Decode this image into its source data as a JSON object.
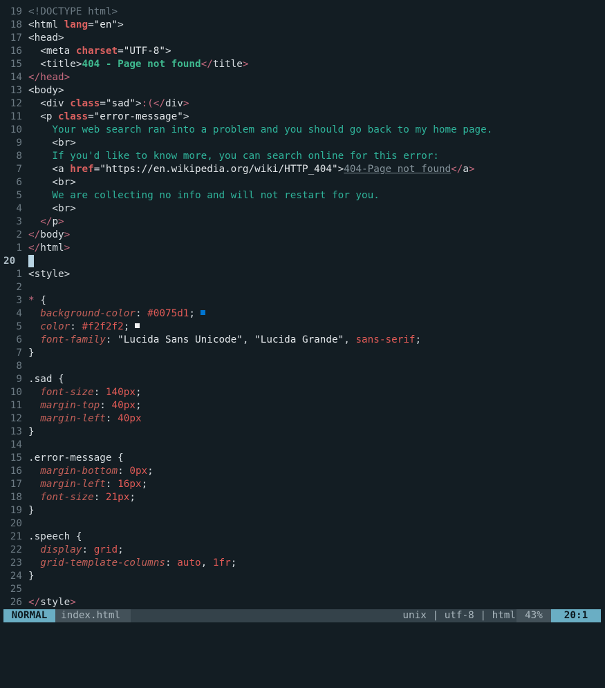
{
  "editor": {
    "cursor_line_number": "20",
    "html_lines": [
      {
        "n": "19",
        "parts": [
          {
            "c": "c-doctype",
            "t": "<!DOCTYPE html>"
          }
        ]
      },
      {
        "n": "18",
        "parts": [
          {
            "c": "c-tag",
            "t": "<html "
          },
          {
            "c": "c-attr",
            "t": "lang"
          },
          {
            "c": "c-eq",
            "t": "="
          },
          {
            "c": "c-str",
            "t": "\"en\""
          },
          {
            "c": "c-tag",
            "t": ">"
          }
        ]
      },
      {
        "n": "17",
        "parts": [
          {
            "c": "c-tag",
            "t": "<head>"
          }
        ]
      },
      {
        "n": "16",
        "parts": [
          {
            "c": "c-tag",
            "t": "  <meta "
          },
          {
            "c": "c-attr",
            "t": "charset"
          },
          {
            "c": "c-eq",
            "t": "="
          },
          {
            "c": "c-str",
            "t": "\"UTF-8\""
          },
          {
            "c": "c-tag",
            "t": ">"
          }
        ]
      },
      {
        "n": "15",
        "parts": [
          {
            "c": "c-tag",
            "t": "  <title>"
          },
          {
            "c": "c-title",
            "t": "404 - Page not found"
          },
          {
            "c": "c-endtag",
            "t": "</"
          },
          {
            "c": "c-tag",
            "t": "title"
          },
          {
            "c": "c-endtag",
            "t": ">"
          }
        ]
      },
      {
        "n": "14",
        "parts": [
          {
            "c": "c-endtag",
            "t": "</head>"
          }
        ]
      },
      {
        "n": "13",
        "parts": [
          {
            "c": "c-tag",
            "t": "<body>"
          }
        ]
      },
      {
        "n": "12",
        "parts": [
          {
            "c": "c-tag",
            "t": "  <div "
          },
          {
            "c": "c-attr",
            "t": "class"
          },
          {
            "c": "c-eq",
            "t": "="
          },
          {
            "c": "c-str",
            "t": "\"sad\""
          },
          {
            "c": "c-tag",
            "t": ">"
          },
          {
            "c": "c-sad",
            "t": ":("
          },
          {
            "c": "c-endtag",
            "t": "</"
          },
          {
            "c": "c-tag",
            "t": "div"
          },
          {
            "c": "c-endtag",
            "t": ">"
          }
        ]
      },
      {
        "n": "11",
        "parts": [
          {
            "c": "c-tag",
            "t": "  <p "
          },
          {
            "c": "c-attr",
            "t": "class"
          },
          {
            "c": "c-eq",
            "t": "="
          },
          {
            "c": "c-str",
            "t": "\"error-message\""
          },
          {
            "c": "c-tag",
            "t": ">"
          }
        ]
      },
      {
        "n": "10",
        "parts": [
          {
            "c": "c-text",
            "t": "    Your web search ran into a problem and you should go back to my home page."
          }
        ]
      },
      {
        "n": "9",
        "parts": [
          {
            "c": "c-tag",
            "t": "    <br>"
          }
        ]
      },
      {
        "n": "8",
        "parts": [
          {
            "c": "c-text",
            "t": "    If you'd like to know more, you can search online for this error:"
          }
        ]
      },
      {
        "n": "7",
        "parts": [
          {
            "c": "c-tag",
            "t": "    <a "
          },
          {
            "c": "c-attr",
            "t": "href"
          },
          {
            "c": "c-eq",
            "t": "="
          },
          {
            "c": "c-str",
            "t": "\"https://en.wikipedia.org/wiki/HTTP_404\""
          },
          {
            "c": "c-tag",
            "t": ">"
          },
          {
            "c": "c-link",
            "t": "404-Page not found"
          },
          {
            "c": "c-endtag",
            "t": "</"
          },
          {
            "c": "c-tag",
            "t": "a"
          },
          {
            "c": "c-endtag",
            "t": ">"
          }
        ]
      },
      {
        "n": "6",
        "parts": [
          {
            "c": "c-tag",
            "t": "    <br>"
          }
        ]
      },
      {
        "n": "5",
        "parts": [
          {
            "c": "c-text",
            "t": "    We are collecting no info and will not restart for you."
          }
        ]
      },
      {
        "n": "4",
        "parts": [
          {
            "c": "c-tag",
            "t": "    <br>"
          }
        ]
      },
      {
        "n": "3",
        "parts": [
          {
            "c": "c-endtag",
            "t": "  </"
          },
          {
            "c": "c-tag",
            "t": "p"
          },
          {
            "c": "c-endtag",
            "t": ">"
          }
        ]
      },
      {
        "n": "2",
        "parts": [
          {
            "c": "c-endtag",
            "t": "</"
          },
          {
            "c": "c-tag",
            "t": "body"
          },
          {
            "c": "c-endtag",
            "t": ">"
          }
        ]
      },
      {
        "n": "1",
        "parts": [
          {
            "c": "c-endtag",
            "t": "</"
          },
          {
            "c": "c-tag",
            "t": "html"
          },
          {
            "c": "c-endtag",
            "t": ">"
          }
        ]
      }
    ],
    "css_lines": [
      {
        "n": "1",
        "parts": [
          {
            "c": "c-tag",
            "t": "<style>"
          }
        ]
      },
      {
        "n": "2",
        "parts": []
      },
      {
        "n": "3",
        "parts": [
          {
            "c": "c-endtag",
            "t": "*"
          },
          {
            "c": "c-brace",
            "t": " {"
          }
        ]
      },
      {
        "n": "4",
        "parts": [
          {
            "c": "c-prop",
            "t": "  background-color"
          },
          {
            "c": "c-colon",
            "t": ": "
          },
          {
            "c": "c-val",
            "t": "#0075d1"
          },
          {
            "c": "c-colon",
            "t": ";"
          }
        ],
        "swatch": "#0075d1"
      },
      {
        "n": "5",
        "parts": [
          {
            "c": "c-prop",
            "t": "  color"
          },
          {
            "c": "c-colon",
            "t": ": "
          },
          {
            "c": "c-val",
            "t": "#f2f2f2"
          },
          {
            "c": "c-colon",
            "t": ";"
          }
        ],
        "swatch": "#f2f2f2"
      },
      {
        "n": "6",
        "parts": [
          {
            "c": "c-prop",
            "t": "  font-family"
          },
          {
            "c": "c-colon",
            "t": ": "
          },
          {
            "c": "c-valstr",
            "t": "\"Lucida Sans Unicode\""
          },
          {
            "c": "c-comma",
            "t": ", "
          },
          {
            "c": "c-valstr",
            "t": "\"Lucida Grande\""
          },
          {
            "c": "c-comma",
            "t": ", "
          },
          {
            "c": "c-val",
            "t": "sans-serif"
          },
          {
            "c": "c-colon",
            "t": ";"
          }
        ]
      },
      {
        "n": "7",
        "parts": [
          {
            "c": "c-brace",
            "t": "}"
          }
        ]
      },
      {
        "n": "8",
        "parts": []
      },
      {
        "n": "9",
        "parts": [
          {
            "c": "c-sel",
            "t": ".sad {"
          }
        ]
      },
      {
        "n": "10",
        "parts": [
          {
            "c": "c-prop",
            "t": "  font-size"
          },
          {
            "c": "c-colon",
            "t": ": "
          },
          {
            "c": "c-val",
            "t": "140px"
          },
          {
            "c": "c-colon",
            "t": ";"
          }
        ]
      },
      {
        "n": "11",
        "parts": [
          {
            "c": "c-prop",
            "t": "  margin-top"
          },
          {
            "c": "c-colon",
            "t": ": "
          },
          {
            "c": "c-val",
            "t": "40px"
          },
          {
            "c": "c-colon",
            "t": ";"
          }
        ]
      },
      {
        "n": "12",
        "parts": [
          {
            "c": "c-prop",
            "t": "  margin-left"
          },
          {
            "c": "c-colon",
            "t": ": "
          },
          {
            "c": "c-val",
            "t": "40px"
          }
        ]
      },
      {
        "n": "13",
        "parts": [
          {
            "c": "c-brace",
            "t": "}"
          }
        ]
      },
      {
        "n": "14",
        "parts": []
      },
      {
        "n": "15",
        "parts": [
          {
            "c": "c-sel",
            "t": ".error-message {"
          }
        ]
      },
      {
        "n": "16",
        "parts": [
          {
            "c": "c-prop",
            "t": "  margin-bottom"
          },
          {
            "c": "c-colon",
            "t": ": "
          },
          {
            "c": "c-val",
            "t": "0px"
          },
          {
            "c": "c-colon",
            "t": ";"
          }
        ]
      },
      {
        "n": "17",
        "parts": [
          {
            "c": "c-prop",
            "t": "  margin-left"
          },
          {
            "c": "c-colon",
            "t": ": "
          },
          {
            "c": "c-val",
            "t": "16px"
          },
          {
            "c": "c-colon",
            "t": ";"
          }
        ]
      },
      {
        "n": "18",
        "parts": [
          {
            "c": "c-prop",
            "t": "  font-size"
          },
          {
            "c": "c-colon",
            "t": ": "
          },
          {
            "c": "c-val",
            "t": "21px"
          },
          {
            "c": "c-colon",
            "t": ";"
          }
        ]
      },
      {
        "n": "19",
        "parts": [
          {
            "c": "c-brace",
            "t": "}"
          }
        ]
      },
      {
        "n": "20",
        "parts": []
      },
      {
        "n": "21",
        "parts": [
          {
            "c": "c-sel",
            "t": ".speech {"
          }
        ]
      },
      {
        "n": "22",
        "parts": [
          {
            "c": "c-prop",
            "t": "  display"
          },
          {
            "c": "c-colon",
            "t": ": "
          },
          {
            "c": "c-val",
            "t": "grid"
          },
          {
            "c": "c-colon",
            "t": ";"
          }
        ]
      },
      {
        "n": "23",
        "parts": [
          {
            "c": "c-prop",
            "t": "  grid-template-columns"
          },
          {
            "c": "c-colon",
            "t": ": "
          },
          {
            "c": "c-val",
            "t": "auto"
          },
          {
            "c": "c-comma",
            "t": ", "
          },
          {
            "c": "c-val",
            "t": "1fr"
          },
          {
            "c": "c-colon",
            "t": ";"
          }
        ]
      },
      {
        "n": "24",
        "parts": [
          {
            "c": "c-brace",
            "t": "}"
          }
        ]
      },
      {
        "n": "25",
        "parts": []
      },
      {
        "n": "26",
        "parts": [
          {
            "c": "c-endtag",
            "t": "</"
          },
          {
            "c": "c-tag",
            "t": "style"
          },
          {
            "c": "c-endtag",
            "t": ">"
          }
        ]
      }
    ]
  },
  "statusline": {
    "mode": "NORMAL",
    "filename": "index.html",
    "fileformat": "unix",
    "encoding": "utf-8",
    "filetype": "html",
    "separator": " | ",
    "percent": "43%",
    "position": "20:1"
  }
}
